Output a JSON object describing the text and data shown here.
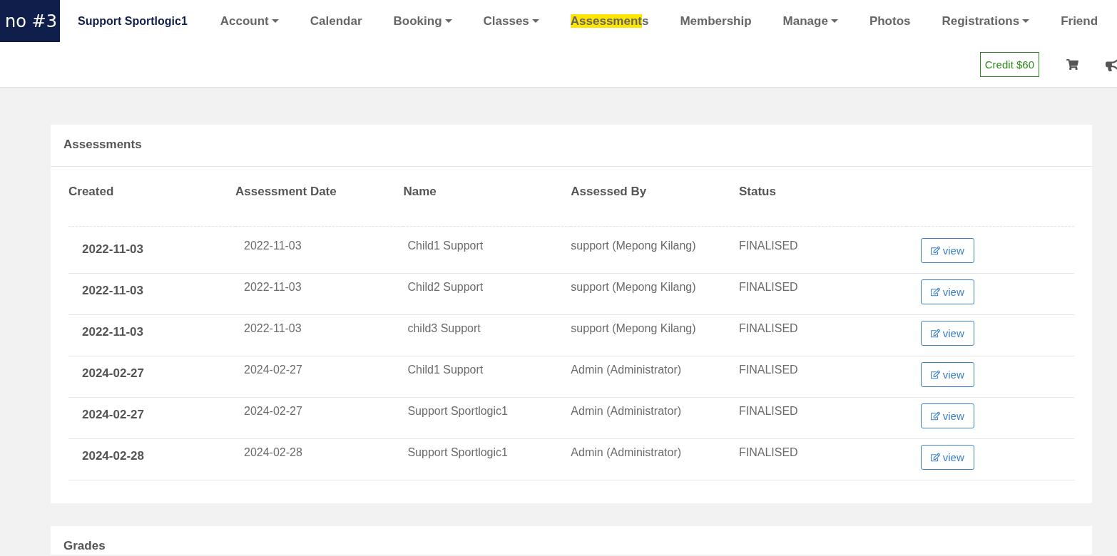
{
  "brand": {
    "text": "no #3"
  },
  "nav": [
    {
      "label_parts": [
        {
          "text": "Support Sportlogic1",
          "highlighted": false
        }
      ],
      "kind": "user",
      "dropdown": false
    },
    {
      "label_parts": [
        {
          "text": "Account",
          "highlighted": false
        }
      ],
      "kind": "link",
      "dropdown": true
    },
    {
      "label_parts": [
        {
          "text": "Calendar",
          "highlighted": false
        }
      ],
      "kind": "link",
      "dropdown": false
    },
    {
      "label_parts": [
        {
          "text": "Booking",
          "highlighted": false
        }
      ],
      "kind": "link",
      "dropdown": true
    },
    {
      "label_parts": [
        {
          "text": "Classes",
          "highlighted": false
        }
      ],
      "kind": "link",
      "dropdown": true
    },
    {
      "label_parts": [
        {
          "text": "Assessment",
          "highlighted": true
        },
        {
          "text": "s",
          "highlighted": false
        }
      ],
      "kind": "link",
      "dropdown": false
    },
    {
      "label_parts": [
        {
          "text": "Membership",
          "highlighted": false
        }
      ],
      "kind": "link",
      "dropdown": false
    },
    {
      "label_parts": [
        {
          "text": "Manage",
          "highlighted": false
        }
      ],
      "kind": "link",
      "dropdown": true
    },
    {
      "label_parts": [
        {
          "text": "Photos",
          "highlighted": false
        }
      ],
      "kind": "link",
      "dropdown": false
    },
    {
      "label_parts": [
        {
          "text": "Registrations",
          "highlighted": false
        }
      ],
      "kind": "link",
      "dropdown": true
    },
    {
      "label_parts": [
        {
          "text": "Friend",
          "highlighted": false
        }
      ],
      "kind": "link",
      "dropdown": false
    }
  ],
  "credit": "Credit $60",
  "assessments": {
    "title": "Assessments",
    "columns": [
      "Created",
      "Assessment Date",
      "Name",
      "Assessed By",
      "Status"
    ],
    "rows": [
      {
        "created": "2022-11-03",
        "date": "2022-11-03",
        "name": "Child1 Support",
        "assessed_by": "support (Mepong Kilang)",
        "status": "FINALISED",
        "action": "view"
      },
      {
        "created": "2022-11-03",
        "date": "2022-11-03",
        "name": "Child2 Support",
        "assessed_by": "support (Mepong Kilang)",
        "status": "FINALISED",
        "action": "view"
      },
      {
        "created": "2022-11-03",
        "date": "2022-11-03",
        "name": "child3 Support",
        "assessed_by": "support (Mepong Kilang)",
        "status": "FINALISED",
        "action": "view"
      },
      {
        "created": "2024-02-27",
        "date": "2024-02-27",
        "name": "Child1 Support",
        "assessed_by": "Admin (Administrator)",
        "status": "FINALISED",
        "action": "view"
      },
      {
        "created": "2024-02-27",
        "date": "2024-02-27",
        "name": "Support Sportlogic1",
        "assessed_by": "Admin (Administrator)",
        "status": "FINALISED",
        "action": "view"
      },
      {
        "created": "2024-02-28",
        "date": "2024-02-28",
        "name": "Support Sportlogic1",
        "assessed_by": "Admin (Administrator)",
        "status": "FINALISED",
        "action": "view"
      }
    ]
  },
  "grades": {
    "title": "Grades"
  }
}
